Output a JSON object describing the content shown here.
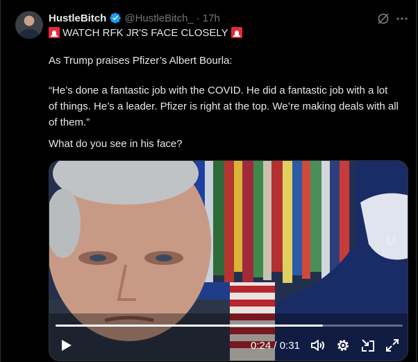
{
  "post": {
    "author_name": "HustleBitch",
    "handle": "@HustleBitch_",
    "separator": "·",
    "time": "17h",
    "headline": "WATCH RFK JR'S FACE CLOSELY",
    "intro": "As Trump praises Pfizer’s Albert Bourla:",
    "quote_lines": [
      "“He’s done a fantastic job with the COVID. He did a fantastic job with a lot",
      "of things. He’s a leader. Pfizer is right at the top. We’re making deals with all",
      "of them.”"
    ],
    "question": "What do you see in his face?"
  },
  "video": {
    "current_time": "0:24",
    "time_separator": "/",
    "duration": "0:31",
    "progress": 0.77,
    "banner_text": "U"
  },
  "icons": {
    "verified": "verified-badge-icon",
    "grok": "grok-icon",
    "more": "more-icon",
    "headline_emoji": "siren-icon",
    "play": "play-icon",
    "volume": "volume-icon",
    "settings": "settings-icon",
    "pip": "picture-in-picture-icon",
    "fullscreen": "fullscreen-icon"
  },
  "colors": {
    "background": "#000000",
    "text": "#e7e9ea",
    "muted": "#71767b",
    "verified": "#1d9bf0",
    "siren": "#e8283c"
  }
}
